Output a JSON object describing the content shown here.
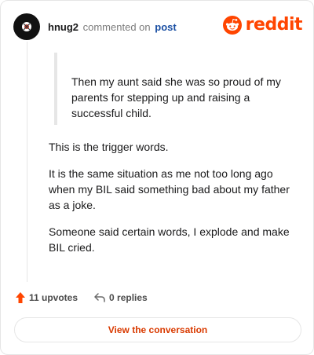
{
  "header": {
    "username": "hnug2",
    "action_text": "commented on",
    "post_link": "post",
    "brand": "reddit"
  },
  "comment": {
    "quote": "Then my aunt said she was so proud of my parents for stepping up and raising a successful child.",
    "paragraphs": [
      "This is the trigger words.",
      "It is the same situation as me not too long ago when my BIL said something bad about my father as a joke.",
      "Someone said certain words, I explode and make BIL cried."
    ]
  },
  "footer": {
    "upvotes": "11 upvotes",
    "replies": "0 replies",
    "view_button": "View the conversation"
  },
  "colors": {
    "accent": "#ff4500",
    "button_text": "#d93a00",
    "link": "#1a4fa3"
  },
  "icons": {
    "avatar": "avatar-icon",
    "brand": "reddit-alien-icon",
    "upvote": "upvote-arrow-icon",
    "reply": "reply-arrow-icon"
  }
}
